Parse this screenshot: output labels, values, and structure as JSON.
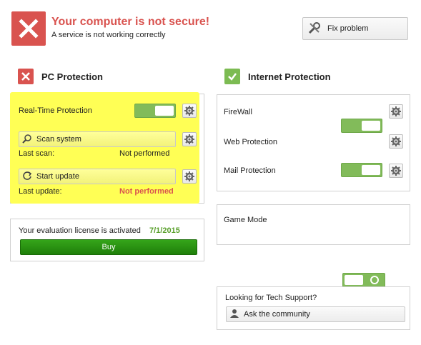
{
  "header": {
    "title": "Your computer is not secure!",
    "subtitle": "A service is not working correctly",
    "fix_label": "Fix problem"
  },
  "pc_protection": {
    "title": "PC Protection",
    "status_color": "#d9534f",
    "realtime_label": "Real-Time Protection",
    "scan_label": "Scan system",
    "last_scan_label": "Last scan:",
    "last_scan_value": "Not performed",
    "update_label": "Start update",
    "last_update_label": "Last update:",
    "last_update_value": "Not performed"
  },
  "license": {
    "text": "Your evaluation license is activated",
    "date": "7/1/2015",
    "buy_label": "Buy"
  },
  "internet_protection": {
    "title": "Internet Protection",
    "status_color": "#7cbb52",
    "items": [
      {
        "label": "FireWall"
      },
      {
        "label": "Web Protection"
      },
      {
        "label": "Mail Protection"
      }
    ]
  },
  "game_mode": {
    "label": "Game Mode"
  },
  "support": {
    "question": "Looking for Tech Support?",
    "community_label": "Ask the community"
  },
  "colors": {
    "accent_red": "#d9534f",
    "accent_green": "#82bb5a",
    "highlight": "#ffff55",
    "buy_green": "#2a9414"
  }
}
